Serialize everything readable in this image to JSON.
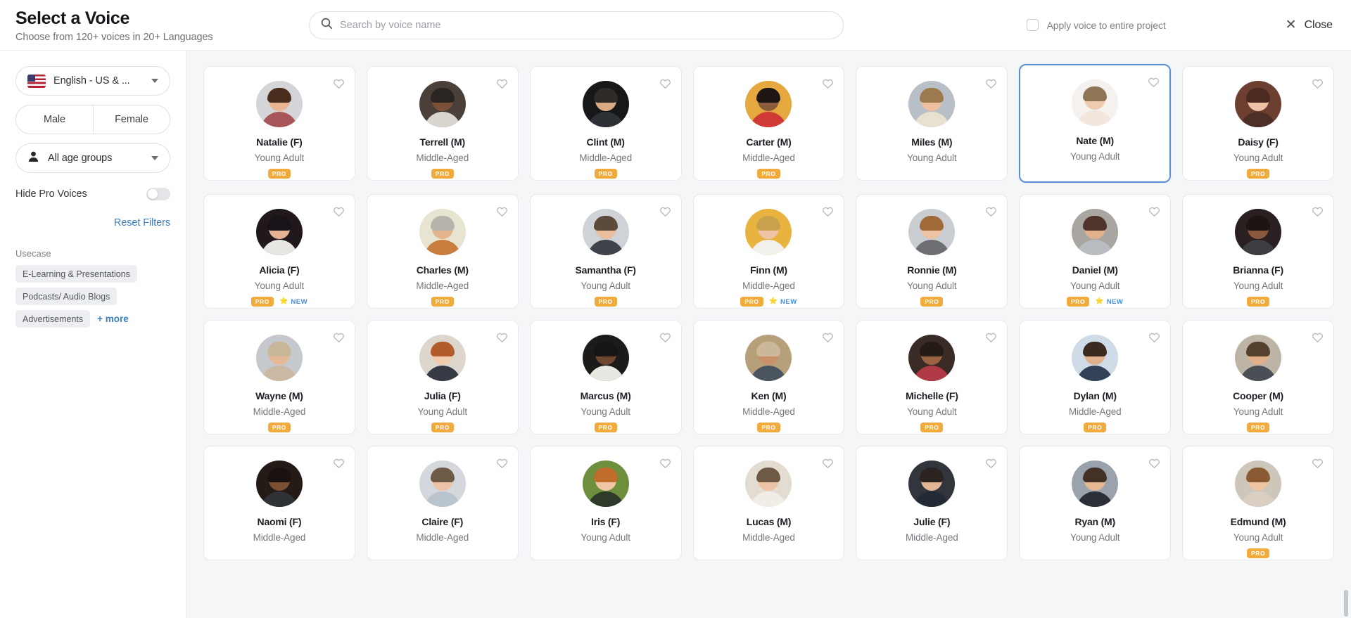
{
  "header": {
    "title": "Select a Voice",
    "subtitle": "Choose from 120+ voices in 20+ Languages",
    "search": {
      "placeholder": "Search by voice name",
      "value": ""
    },
    "apply_checkbox_label": "Apply voice to entire project",
    "apply_checked": false,
    "close_label": "Close",
    "close_icon": "close-x-icon"
  },
  "sidebar": {
    "language": {
      "label": "English - US & ...",
      "icon": "us-flag-icon",
      "caret": "chevron-down-icon"
    },
    "gender": {
      "male": "Male",
      "female": "Female",
      "selected": ""
    },
    "age": {
      "label": "All age groups",
      "icon": "person-icon",
      "caret": "chevron-down-icon"
    },
    "hide_pro": {
      "label": "Hide Pro Voices",
      "on": false
    },
    "reset": "Reset Filters",
    "usecase_title": "Usecase",
    "usecase_tags": [
      "E-Learning & Presentations",
      "Podcasts/ Audio Blogs",
      "Advertisements"
    ],
    "more_label": "+ more"
  },
  "colors": {
    "accent_blue": "#3b7fc4",
    "selected_border": "#5b8fd4",
    "pro_badge": "#f0ab3c",
    "new_text": "#4a8ddc",
    "grid_bg": "#f5f6f8"
  },
  "grid": {
    "favorite_icon": "heart-icon",
    "pro_label": "PRO",
    "new_label": "NEW",
    "new_icon": "star-icon",
    "voices": [
      {
        "name": "Natalie (F)",
        "age": "Young Adult",
        "pro": true,
        "new": false,
        "selected": false,
        "hair": "#4a2c1d",
        "skin": "#e8b492",
        "shirt": "#a8555a",
        "bg": "#d3d5d9"
      },
      {
        "name": "Terrell (M)",
        "age": "Middle-Aged",
        "pro": true,
        "new": false,
        "selected": false,
        "hair": "#2a2422",
        "skin": "#7b5138",
        "shirt": "#d8d5cf",
        "bg": "#4b4039"
      },
      {
        "name": "Clint (M)",
        "age": "Middle-Aged",
        "pro": true,
        "new": false,
        "selected": false,
        "hair": "#2e2b28",
        "skin": "#d9a983",
        "shirt": "#2d3136",
        "bg": "#161719"
      },
      {
        "name": "Carter (M)",
        "age": "Middle-Aged",
        "pro": true,
        "new": false,
        "selected": false,
        "hair": "#1d1612",
        "skin": "#8a5c3c",
        "shirt": "#cf3a35",
        "bg": "#e6a93f"
      },
      {
        "name": "Miles (M)",
        "age": "Young Adult",
        "pro": false,
        "new": false,
        "selected": false,
        "hair": "#9c7a4e",
        "skin": "#edc0a0",
        "shirt": "#e7e2cf",
        "bg": "#b9bfc6"
      },
      {
        "name": "Nate (M)",
        "age": "Young Adult",
        "pro": false,
        "new": false,
        "selected": true,
        "hair": "#8d7556",
        "skin": "#f0cbb0",
        "shirt": "#f3e6dc",
        "bg": "#f4f1ee"
      },
      {
        "name": "Daisy (F)",
        "age": "Young Adult",
        "pro": true,
        "new": false,
        "selected": false,
        "hair": "#4b2a20",
        "skin": "#eec2a6",
        "shirt": "#4c3028",
        "bg": "#6d3f30"
      },
      {
        "name": "Alicia (F)",
        "age": "Young Adult",
        "pro": true,
        "new": true,
        "selected": false,
        "hair": "#181318",
        "skin": "#e6b294",
        "shirt": "#e8e6e3",
        "bg": "#20181b"
      },
      {
        "name": "Charles (M)",
        "age": "Middle-Aged",
        "pro": true,
        "new": false,
        "selected": false,
        "hair": "#b8b4ad",
        "skin": "#e3b48e",
        "shirt": "#c97d3e",
        "bg": "#e8e4d2"
      },
      {
        "name": "Samantha (F)",
        "age": "Young Adult",
        "pro": true,
        "new": false,
        "selected": false,
        "hair": "#5c4a3a",
        "skin": "#e9bf9f",
        "shirt": "#3f444b",
        "bg": "#cfd2d6"
      },
      {
        "name": "Finn (M)",
        "age": "Middle-Aged",
        "pro": true,
        "new": true,
        "selected": false,
        "hair": "#caa24e",
        "skin": "#eec4a4",
        "shirt": "#f2f0ec",
        "bg": "#e9b33f"
      },
      {
        "name": "Ronnie (M)",
        "age": "Young Adult",
        "pro": true,
        "new": false,
        "selected": false,
        "hair": "#a06a39",
        "skin": "#edc3a3",
        "shirt": "#6d6f74",
        "bg": "#c9cdd2"
      },
      {
        "name": "Daniel (M)",
        "age": "Young Adult",
        "pro": true,
        "new": true,
        "selected": false,
        "hair": "#4e342a",
        "skin": "#e3b08d",
        "shirt": "#b9bdc2",
        "bg": "#a9a6a1"
      },
      {
        "name": "Brianna (F)",
        "age": "Young Adult",
        "pro": true,
        "new": false,
        "selected": false,
        "hair": "#1c1410",
        "skin": "#8b5a3c",
        "shirt": "#3d3d42",
        "bg": "#2a2022"
      },
      {
        "name": "Wayne (M)",
        "age": "Middle-Aged",
        "pro": true,
        "new": false,
        "selected": false,
        "hair": "#c9b79a",
        "skin": "#e5b995",
        "shirt": "#cbb8a3",
        "bg": "#c5c8cd"
      },
      {
        "name": "Julia (F)",
        "age": "Young Adult",
        "pro": true,
        "new": false,
        "selected": false,
        "hair": "#b25c2c",
        "skin": "#f0cbae",
        "shirt": "#353a45",
        "bg": "#ddd6cd"
      },
      {
        "name": "Marcus (M)",
        "age": "Young Adult",
        "pro": true,
        "new": false,
        "selected": false,
        "hair": "#171513",
        "skin": "#6e4730",
        "shirt": "#e9e7e2",
        "bg": "#1c1b1a"
      },
      {
        "name": "Ken (M)",
        "age": "Middle-Aged",
        "pro": true,
        "new": false,
        "selected": false,
        "hair": "#cbb79a",
        "skin": "#c99169",
        "shirt": "#4a5560",
        "bg": "#b6a07a"
      },
      {
        "name": "Michelle (F)",
        "age": "Young Adult",
        "pro": true,
        "new": false,
        "selected": false,
        "hair": "#241a16",
        "skin": "#9a6444",
        "shirt": "#b03a46",
        "bg": "#3a2b26"
      },
      {
        "name": "Dylan (M)",
        "age": "Middle-Aged",
        "pro": true,
        "new": false,
        "selected": false,
        "hair": "#3a2a20",
        "skin": "#e0b28f",
        "shirt": "#324258",
        "bg": "#cfdbe6"
      },
      {
        "name": "Cooper (M)",
        "age": "Young Adult",
        "pro": true,
        "new": false,
        "selected": false,
        "hair": "#55402e",
        "skin": "#dfb089",
        "shirt": "#4a4f55",
        "bg": "#bdb4a5"
      },
      {
        "name": "Naomi (F)",
        "age": "Middle-Aged",
        "pro": false,
        "new": false,
        "selected": false,
        "hair": "#1a1210",
        "skin": "#7d5034",
        "shirt": "#2e3136",
        "bg": "#241b17"
      },
      {
        "name": "Claire (F)",
        "age": "Middle-Aged",
        "pro": false,
        "new": false,
        "selected": false,
        "hair": "#6d5a47",
        "skin": "#ecc3a6",
        "shirt": "#b9c4cc",
        "bg": "#d4d7db"
      },
      {
        "name": "Iris (F)",
        "age": "Young Adult",
        "pro": false,
        "new": false,
        "selected": false,
        "hair": "#c06c2a",
        "skin": "#f0c6a6",
        "shirt": "#2f3b2a",
        "bg": "#6d8f3e"
      },
      {
        "name": "Lucas (M)",
        "age": "Middle-Aged",
        "pro": false,
        "new": false,
        "selected": false,
        "hair": "#6e5a44",
        "skin": "#ecc3a4",
        "shirt": "#f0ece6",
        "bg": "#e3dcd2"
      },
      {
        "name": "Julie (F)",
        "age": "Middle-Aged",
        "pro": false,
        "new": false,
        "selected": false,
        "hair": "#2b2320",
        "skin": "#e0b694",
        "shirt": "#222a33",
        "bg": "#32353b"
      },
      {
        "name": "Ryan (M)",
        "age": "Young Adult",
        "pro": false,
        "new": false,
        "selected": false,
        "hair": "#443125",
        "skin": "#e6b892",
        "shirt": "#2b3038",
        "bg": "#9aa3ac"
      },
      {
        "name": "Edmund (M)",
        "age": "Young Adult",
        "pro": true,
        "new": false,
        "selected": false,
        "hair": "#8a5a32",
        "skin": "#edc5a4",
        "shirt": "#d9cfc2",
        "bg": "#cdc6bb"
      }
    ]
  }
}
